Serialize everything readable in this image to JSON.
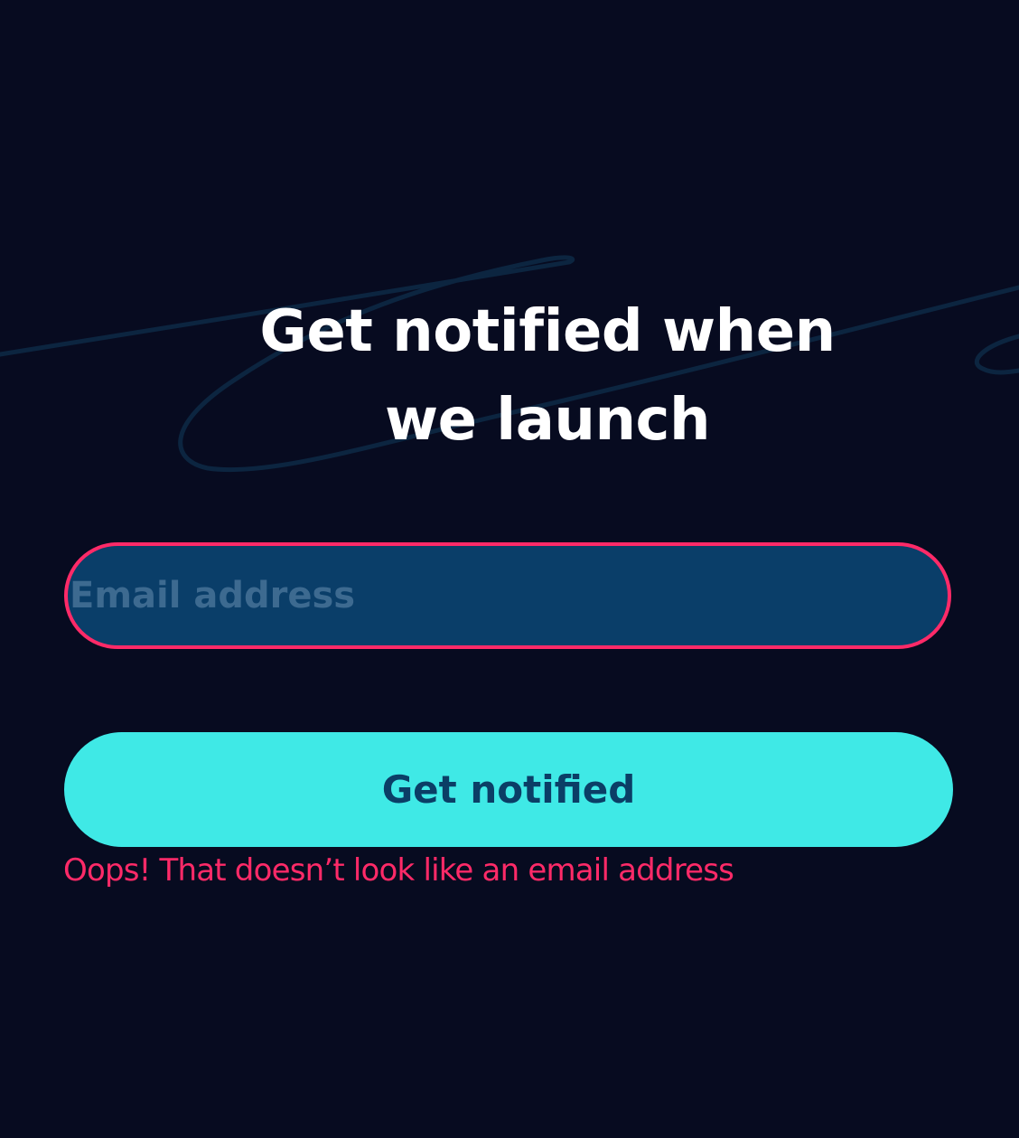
{
  "heading": {
    "line1": "Get notified when",
    "line2": "we launch"
  },
  "email": {
    "value": "",
    "placeholder": "Email address"
  },
  "submit": {
    "label": "Get notified"
  },
  "error": {
    "message": "Oops! That doesn’t look like an email address"
  },
  "colors": {
    "background": "#070b20",
    "input_fill": "#0a3e69",
    "error": "#ff2a68",
    "button": "#3fe9e6",
    "button_text": "#0b3e66"
  },
  "icons": [
    "signature-scribble"
  ]
}
